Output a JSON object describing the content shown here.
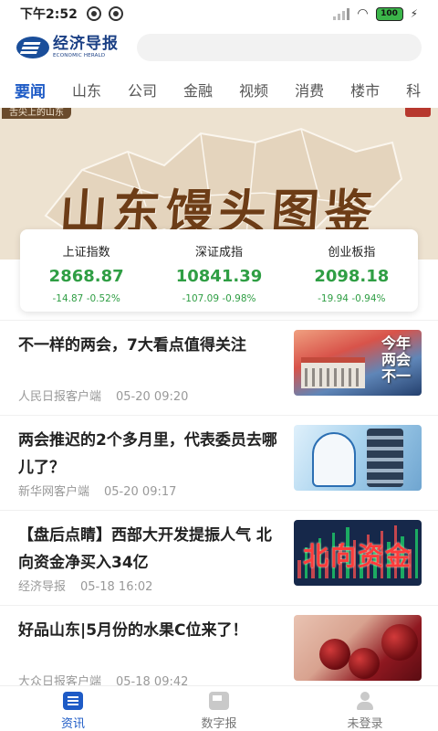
{
  "status_bar": {
    "time": "下午2:52",
    "battery": "100"
  },
  "header": {
    "logo_cn": "经济导报",
    "logo_en": "ECONOMIC HERALD",
    "search_placeholder": ""
  },
  "tabs": [
    {
      "label": "要闻",
      "active": true
    },
    {
      "label": "山东"
    },
    {
      "label": "公司"
    },
    {
      "label": "金融"
    },
    {
      "label": "视频"
    },
    {
      "label": "消费"
    },
    {
      "label": "楼市"
    },
    {
      "label": "科"
    }
  ],
  "banner": {
    "title": "山东馒头图鉴",
    "tag": "舌尖上的山东"
  },
  "indices": [
    {
      "name": "上证指数",
      "value": "2868.87",
      "change": "-14.87",
      "percent": "-0.52%"
    },
    {
      "name": "深证成指",
      "value": "10841.39",
      "change": "-107.09",
      "percent": "-0.98%"
    },
    {
      "name": "创业板指",
      "value": "2098.18",
      "change": "-19.94",
      "percent": "-0.94%"
    }
  ],
  "news": [
    {
      "title": "不一样的两会，7大看点值得关注",
      "source": "人民日报客户端",
      "time": "05-20 09:20",
      "thumb_text": "今年两会不一"
    },
    {
      "title": "两会推迟的2个多月里，代表委员去哪儿了？",
      "source": "新华网客户端",
      "time": "05-20 09:17",
      "thumb_text": ""
    },
    {
      "title": "【盘后点睛】西部大开发提振人气 北向资金净买入34亿",
      "source": "经济导报",
      "time": "05-18 16:02",
      "thumb_text": "北向资金"
    },
    {
      "title": "好品山东|5月份的水果C位来了！",
      "source": "大众日报客户端",
      "time": "05-18 09:42",
      "thumb_text": ""
    }
  ],
  "bottom_nav": [
    {
      "label": "资讯",
      "icon": "news-icon",
      "active": true
    },
    {
      "label": "数字报",
      "icon": "newspaper-icon"
    },
    {
      "label": "未登录",
      "icon": "user-icon"
    }
  ],
  "colors": {
    "accent": "#1e5bc6",
    "index_green": "#2f9e44",
    "brand": "#1a3f84"
  }
}
